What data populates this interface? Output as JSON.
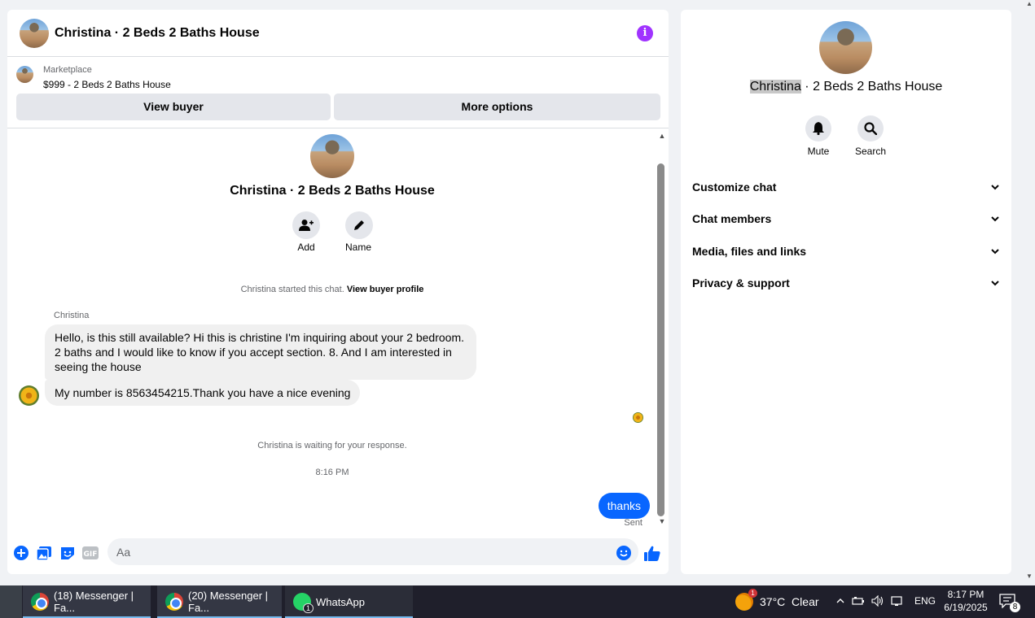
{
  "chat": {
    "title": "Christina · 2 Beds 2 Baths House",
    "marketplace_label": "Marketplace",
    "listing": "$999 - 2 Beds 2 Baths House",
    "view_buyer_label": "View buyer",
    "more_options_label": "More options",
    "intro_title": "Christina · 2 Beds 2 Baths House",
    "add_label": "Add",
    "name_label": "Name",
    "started_text": "Christina started this chat.",
    "view_profile_link": "View buyer profile",
    "sender_name": "Christina",
    "messages_in": [
      "Hello, is this still available? Hi this is christine I'm inquiring about your 2 bedroom. 2 baths and I would like to know if you accept section. 8. And I am interested in seeing the house",
      "My number is 8563454215.Thank you have a nice evening"
    ],
    "waiting_text": "Christina is waiting for your response.",
    "timestamp": "8:16 PM",
    "message_out": "thanks",
    "sent_status": "Sent",
    "composer_placeholder": "Aa"
  },
  "info": {
    "title_highlight": "Christina",
    "title_rest": " · 2 Beds 2 Baths House",
    "mute_label": "Mute",
    "search_label": "Search",
    "sections": [
      "Customize chat",
      "Chat members",
      "Media, files and links",
      "Privacy & support"
    ]
  },
  "taskbar": {
    "items": [
      "(18) Messenger | Fa...",
      "(20) Messenger | Fa...",
      "WhatsApp"
    ],
    "whatsapp_badge": "1",
    "weather_alert": "1",
    "weather": "37°C  Clear",
    "language": "ENG",
    "time": "8:17 PM",
    "date": "6/19/2025",
    "notification_count": "8"
  },
  "colors": {
    "messenger_blue": "#0866ff",
    "info_purple": "#a033ff",
    "bubble_gray": "#f0f0f0"
  }
}
